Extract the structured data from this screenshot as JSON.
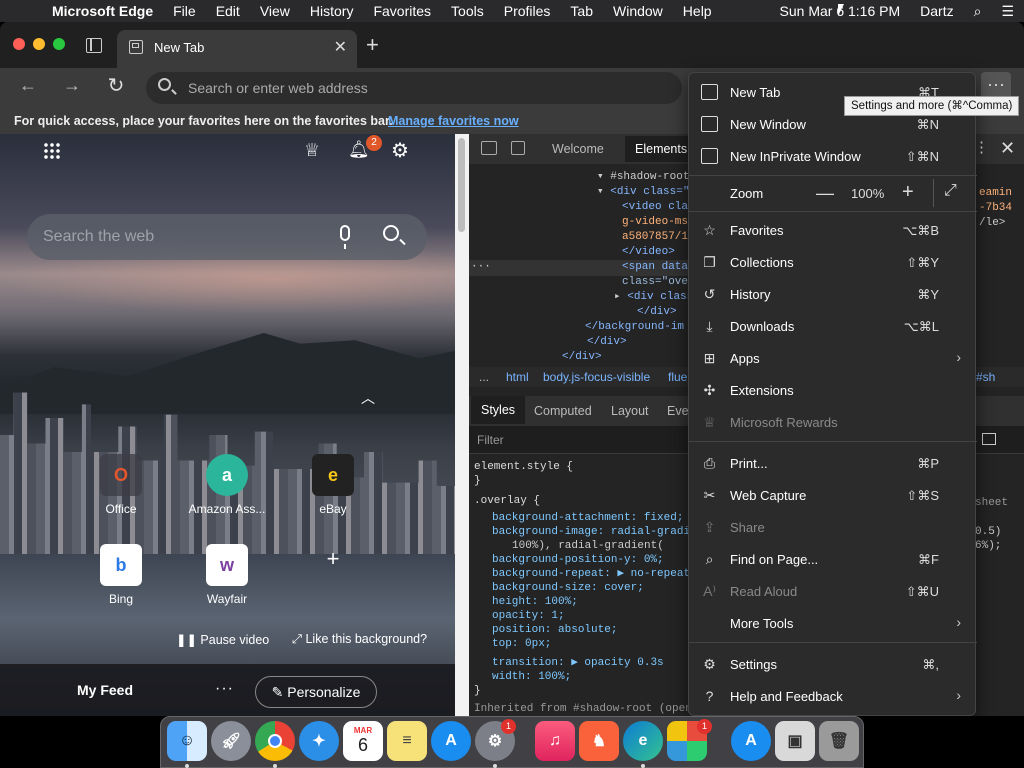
{
  "menubar": {
    "app_name": "Microsoft Edge",
    "items": [
      "File",
      "Edit",
      "View",
      "History",
      "Favorites",
      "Tools",
      "Profiles",
      "Tab",
      "Window",
      "Help"
    ],
    "datetime": "Sun Mar 6  1:16 PM",
    "user": "Dartz"
  },
  "tab": {
    "title": "New Tab"
  },
  "address_bar": {
    "placeholder": "Search or enter web address"
  },
  "favorites_bar": {
    "text": "For quick access, place your favorites here on the favorites bar.",
    "link": "Manage favorites now"
  },
  "tooltip": "Settings and more (⌘^Comma)",
  "ntp": {
    "notification_count": "2",
    "search_placeholder": "Search the web",
    "tiles": [
      {
        "label": "Office",
        "icon": "office-icon",
        "glyph": "O",
        "color": "#e4572e"
      },
      {
        "label": "Amazon Ass...",
        "icon": "amazon-assistant-icon",
        "glyph": "a",
        "color": "#2bb59a"
      },
      {
        "label": "eBay",
        "icon": "ebay-icon",
        "glyph": "e",
        "color": "#3a6fd8"
      },
      {
        "label": "Bing",
        "icon": "bing-icon",
        "glyph": "b",
        "color": "#2c7be5"
      },
      {
        "label": "Wayfair",
        "icon": "wayfair-icon",
        "glyph": "w",
        "color": "#7b3fa0"
      }
    ],
    "pause_label": "Pause video",
    "like_label": "Like this background?",
    "feed_label": "My Feed",
    "feed_more": "···",
    "personalize_label": "Personalize"
  },
  "devtools": {
    "tabs": [
      "Welcome",
      "Elements"
    ],
    "active_tab": "Elements",
    "dom_lines": [
      "#shadow-root",
      "<div class=\"",
      "<video cla",
      "g-video-ms",
      "a5807857/1",
      "</video>",
      "<span data",
      "class=\"ove",
      "<div class",
      "</div>",
      "</background-im",
      "</div>",
      "</div>"
    ],
    "dom_right_fragments": [
      "eamin",
      "-7b34",
      "/le>"
    ],
    "breadcrumbs": [
      "...",
      "html",
      "body.js-focus-visible",
      "flue",
      "#sh"
    ],
    "style_tabs": [
      "Styles",
      "Computed",
      "Layout",
      "Eve"
    ],
    "filter_placeholder": "Filter",
    "css_lines": [
      "element.style {",
      "}",
      ".overlay {",
      "background-attachment: fixed;",
      "background-image: radial-gradi",
      "100%), radial-gradient(",
      "background-position-y: 0%;",
      "background-repeat: ▶ no-repeat",
      "background-size: cover;",
      "height: 100%;",
      "opacity: 1;",
      "position: absolute;",
      "top: 0px;",
      "transition: ▶ opacity 0.3s",
      "width: 100%;",
      "}"
    ],
    "css_right_fragments": [
      "sheet",
      "0.5)",
      "6%);"
    ],
    "inherited_text": "Inherited from #shadow-root (open)"
  },
  "menu": {
    "items": [
      {
        "label": "New Tab",
        "shortcut": "⌘T",
        "icon": "new-tab-icon"
      },
      {
        "label": "New Window",
        "shortcut": "⌘N",
        "icon": "new-window-icon"
      },
      {
        "label": "New InPrivate Window",
        "shortcut": "⇧⌘N",
        "icon": "inprivate-icon"
      },
      {
        "label": "Favorites",
        "shortcut": "⌥⌘B",
        "icon": "favorites-icon"
      },
      {
        "label": "Collections",
        "shortcut": "⇧⌘Y",
        "icon": "collections-icon"
      },
      {
        "label": "History",
        "shortcut": "⌘Y",
        "icon": "history-icon"
      },
      {
        "label": "Downloads",
        "shortcut": "⌥⌘L",
        "icon": "downloads-icon"
      },
      {
        "label": "Apps",
        "shortcut": "",
        "icon": "apps-icon"
      },
      {
        "label": "Extensions",
        "shortcut": "",
        "icon": "extensions-icon"
      },
      {
        "label": "Microsoft Rewards",
        "shortcut": "",
        "icon": "rewards-icon"
      },
      {
        "label": "Print...",
        "shortcut": "⌘P",
        "icon": "print-icon"
      },
      {
        "label": "Web Capture",
        "shortcut": "⇧⌘S",
        "icon": "web-capture-icon"
      },
      {
        "label": "Share",
        "shortcut": "",
        "icon": "share-icon"
      },
      {
        "label": "Find on Page...",
        "shortcut": "⌘F",
        "icon": "find-icon"
      },
      {
        "label": "Read Aloud",
        "shortcut": "⇧⌘U",
        "icon": "read-aloud-icon"
      },
      {
        "label": "More Tools",
        "shortcut": "",
        "icon": ""
      },
      {
        "label": "Settings",
        "shortcut": "⌘,",
        "icon": "settings-icon"
      },
      {
        "label": "Help and Feedback",
        "shortcut": "",
        "icon": "help-icon"
      }
    ],
    "zoom": {
      "label": "Zoom",
      "value": "100%"
    }
  },
  "dock": {
    "calendar_month": "MAR",
    "calendar_day": "6",
    "badges": [
      "1",
      "1",
      "1"
    ],
    "apps": [
      "finder-icon",
      "launchpad-icon",
      "chrome-icon",
      "safari-icon",
      "calendar-icon",
      "notes-icon",
      "app-store-icon",
      "system-preferences-icon",
      "music-icon",
      "brave-icon",
      "edge-icon",
      "microsoft-office-icon",
      "app-store-icon-2",
      "preview-icon",
      "trash-icon"
    ]
  },
  "colors": {
    "accent_link": "#68b0ff",
    "badge": "#e0582a",
    "menu_bg": "#2b2b2b"
  }
}
